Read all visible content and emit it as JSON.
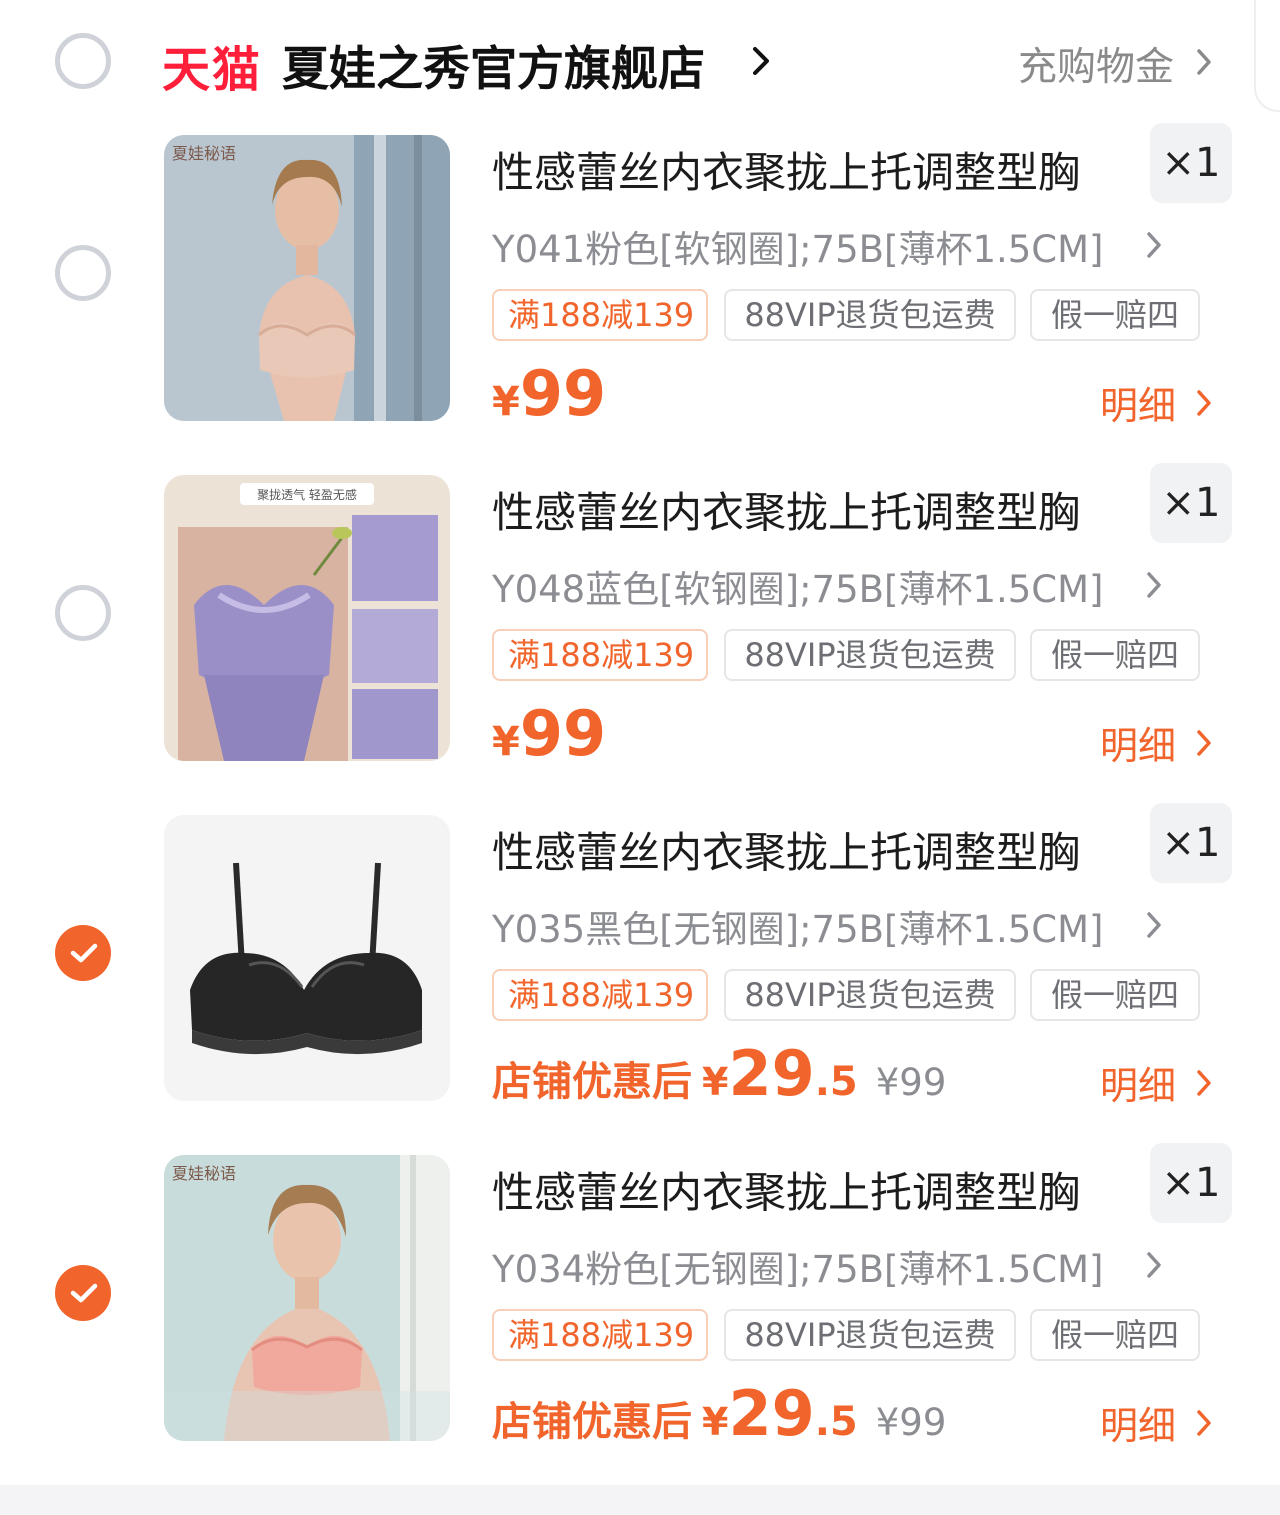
{
  "store": {
    "platform": "天猫",
    "name": "夏娃之秀官方旗舰店",
    "recharge_label": "充购物金"
  },
  "items": [
    {
      "title": "性感蕾丝内衣聚拢上托调整型胸",
      "quantity": "×1",
      "sku": "Y041粉色[软钢圈];75B[薄杯1.5CM]",
      "tags": {
        "promo": "满188减139",
        "vip": "88VIP退货包运费",
        "guarantee": "假一赔四"
      },
      "price_symbol": "¥",
      "price": "99",
      "detail_label": "明细",
      "checked": false,
      "image_watermark": "夏娃秘语"
    },
    {
      "title": "性感蕾丝内衣聚拢上托调整型胸",
      "quantity": "×1",
      "sku": "Y048蓝色[软钢圈];75B[薄杯1.5CM]",
      "tags": {
        "promo": "满188减139",
        "vip": "88VIP退货包运费",
        "guarantee": "假一赔四"
      },
      "price_symbol": "¥",
      "price": "99",
      "detail_label": "明细",
      "checked": false,
      "image_caption": "聚拢透气 轻盈无感"
    },
    {
      "title": "性感蕾丝内衣聚拢上托调整型胸",
      "quantity": "×1",
      "sku": "Y035黑色[无钢圈];75B[薄杯1.5CM]",
      "tags": {
        "promo": "满188减139",
        "vip": "88VIP退货包运费",
        "guarantee": "假一赔四"
      },
      "after_label": "店铺优惠后",
      "price_symbol": "¥",
      "price_int": "29",
      "price_dec": ".5",
      "original_price": "¥99",
      "detail_label": "明细",
      "checked": true
    },
    {
      "title": "性感蕾丝内衣聚拢上托调整型胸",
      "quantity": "×1",
      "sku": "Y034粉色[无钢圈];75B[薄杯1.5CM]",
      "tags": {
        "promo": "满188减139",
        "vip": "88VIP退货包运费",
        "guarantee": "假一赔四"
      },
      "after_label": "店铺优惠后",
      "price_symbol": "¥",
      "price_int": "29",
      "price_dec": ".5",
      "original_price": "¥99",
      "detail_label": "明细",
      "checked": true,
      "image_watermark": "夏娃秘语"
    }
  ],
  "colors": {
    "accent": "#f1642b",
    "tmall_red": "#ff1f3a",
    "muted_text": "#8b8d92"
  }
}
